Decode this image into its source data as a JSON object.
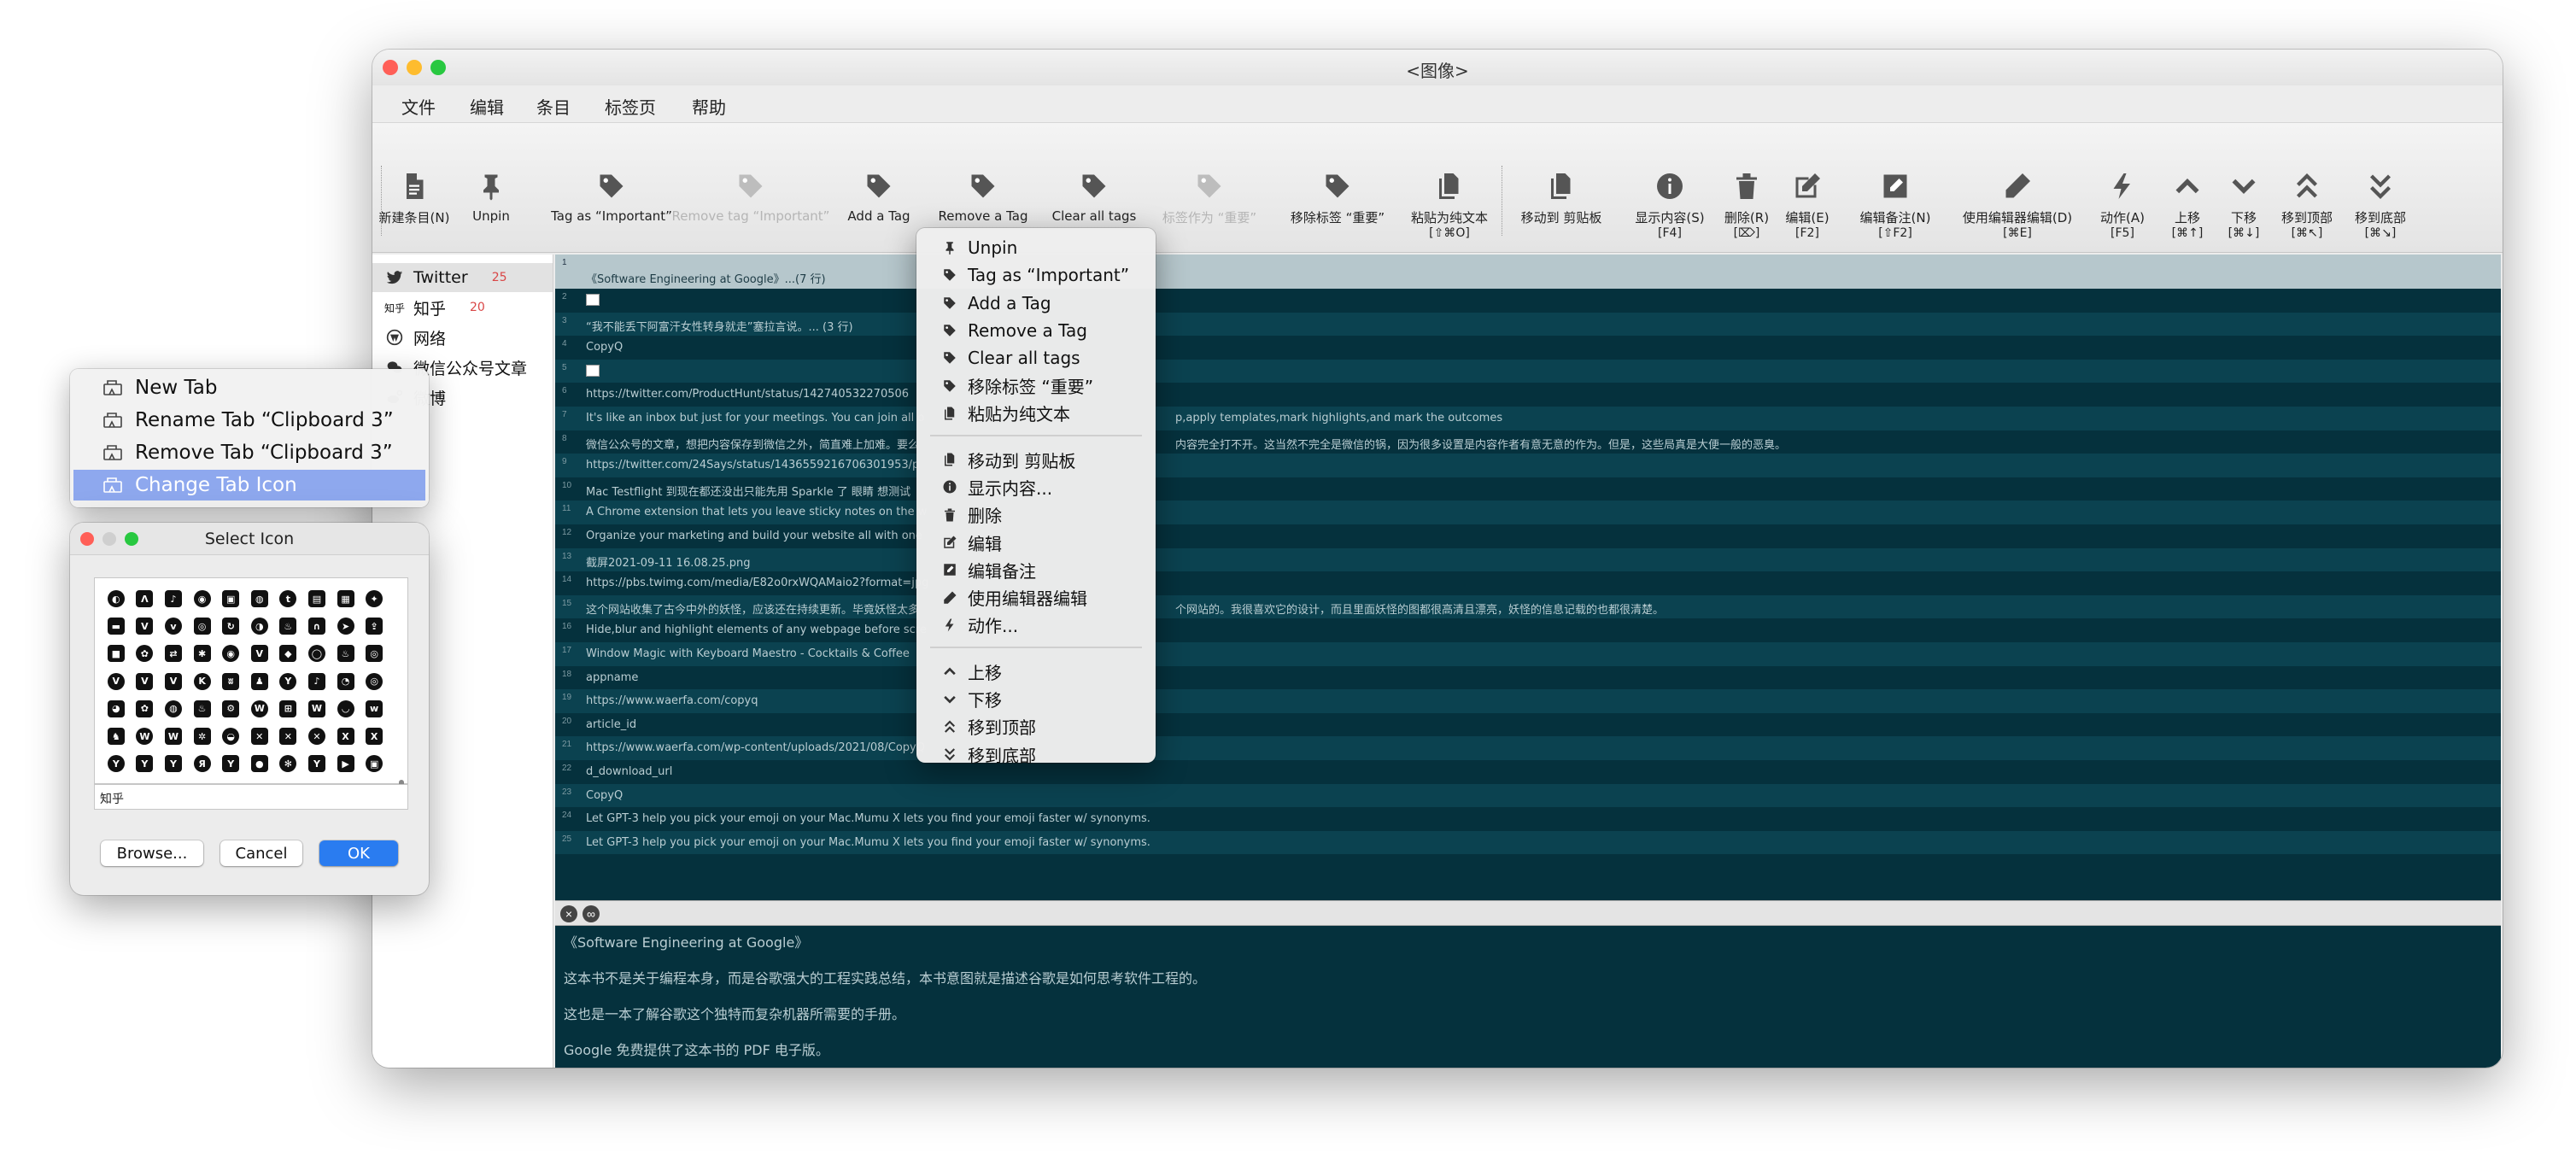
{
  "window": {
    "title": "<图像>"
  },
  "menubar": [
    "文件",
    "编辑",
    "条目",
    "标签页",
    "帮助"
  ],
  "toolbar": [
    {
      "icon": "file-icon",
      "label": "新建条目(N)",
      "enabled": true
    },
    {
      "icon": "pin-icon",
      "label": "Unpin",
      "enabled": true
    },
    {
      "icon": "tag-icon",
      "label": "Tag as “Important”",
      "enabled": true
    },
    {
      "icon": "tag-icon",
      "label": "Remove tag “Important”",
      "enabled": false
    },
    {
      "icon": "tag-icon",
      "label": "Add a Tag",
      "enabled": true
    },
    {
      "icon": "tag-icon",
      "label": "Remove a Tag",
      "enabled": true
    },
    {
      "icon": "tag-icon",
      "label": "Clear all tags",
      "enabled": true
    },
    {
      "icon": "tag-icon",
      "label": "标签作为 “重要”",
      "enabled": false
    },
    {
      "icon": "tag-icon",
      "label": "移除标签 “重要”",
      "enabled": true
    },
    {
      "icon": "copy-icon",
      "label": "粘贴为纯文本",
      "shortcut": "[⇧⌘O]",
      "enabled": true
    },
    {
      "icon": "copy-icon",
      "label": "移动到 剪贴板",
      "enabled": true
    },
    {
      "icon": "info-icon",
      "label": "显示内容(S)",
      "shortcut": "[F4]",
      "enabled": true
    },
    {
      "icon": "trash-icon",
      "label": "删除(R)",
      "shortcut": "[⌦]",
      "enabled": true
    },
    {
      "icon": "edit-icon",
      "label": "编辑(E)",
      "shortcut": "[F2]",
      "enabled": true
    },
    {
      "icon": "edit-note-icon",
      "label": "编辑备注(N)",
      "shortcut": "[⇧F2]",
      "enabled": true
    },
    {
      "icon": "pencil-icon",
      "label": "使用编辑器编辑(D)",
      "shortcut": "[⌘E]",
      "enabled": true
    },
    {
      "icon": "bolt-icon",
      "label": "动作(A)",
      "shortcut": "[F5]",
      "enabled": true
    },
    {
      "icon": "chevron-up-icon",
      "label": "上移",
      "shortcut": "[⌘↑]",
      "enabled": true
    },
    {
      "icon": "chevron-down-icon",
      "label": "下移",
      "shortcut": "[⌘↓]",
      "enabled": true
    },
    {
      "icon": "double-chevron-up-icon",
      "label": "移到顶部",
      "shortcut": "[⌘↖]",
      "enabled": true
    },
    {
      "icon": "double-chevron-down-icon",
      "label": "移到底部",
      "shortcut": "[⌘↘]",
      "enabled": true
    }
  ],
  "sidebar": {
    "tabs": [
      {
        "icon": "twitter-icon",
        "label": "Twitter",
        "count": "25",
        "selected": true
      },
      {
        "icon": "zhihu-icon",
        "icon_text": "知乎",
        "label": "知乎",
        "count": "20",
        "selected": false
      },
      {
        "icon": "wordpress-icon",
        "label": "网络",
        "count": "",
        "selected": false
      },
      {
        "icon": "wechat-icon",
        "label": "微信公众号文章",
        "count": "",
        "selected": false
      },
      {
        "icon": "weibo-icon",
        "label": "微博",
        "count": "",
        "selected": false
      }
    ]
  },
  "items": [
    {
      "num": "1",
      "text": "《Software Engineering at Google》...(7 行)"
    },
    {
      "num": "2",
      "text": "",
      "image": true
    },
    {
      "num": "3",
      "text": "“我不能丢下阿富汗女性转身就走”塞拉言说。... (3 行)"
    },
    {
      "num": "4",
      "text": "CopyQ"
    },
    {
      "num": "5",
      "text": "",
      "image": true
    },
    {
      "num": "6",
      "text": "https://twitter.com/ProductHunt/status/142740532270506"
    },
    {
      "num": "7",
      "text": "It's like an inbox but just for your meetings. You can join all o"
    },
    {
      "num": "8",
      "text": "微信公众号的文章，想把内容保存到微信之外，简直难上加难。要么"
    },
    {
      "num": "9",
      "text": "https://twitter.com/24Says/status/1436559216706301953/p"
    },
    {
      "num": "10",
      "text": "Mac Testflight 到现在都还没出只能先用 Sparkle 了 眼睛 想测试"
    },
    {
      "num": "11",
      "text": "A Chrome extension that lets you leave sticky notes on the w"
    },
    {
      "num": "12",
      "text": "Organize your marketing and build your website all with one"
    },
    {
      "num": "13",
      "text": "截屏2021-09-11 16.08.25.png"
    },
    {
      "num": "14",
      "text": "https://pbs.twimg.com/media/E82o0rxWQAMaio2?format=jpg"
    },
    {
      "num": "15",
      "text": "这个网站收集了古今中外的妖怪，应该还在持续更新。毕竟妖怪太多"
    },
    {
      "num": "16",
      "text": "Hide,blur and highlight elements of any webpage before scre"
    },
    {
      "num": "17",
      "text": "Window Magic with Keyboard Maestro - Cocktails & Coffee"
    },
    {
      "num": "18",
      "text": "appname"
    },
    {
      "num": "19",
      "text": "https://www.waerfa.com/copyq"
    },
    {
      "num": "20",
      "text": "article_id"
    },
    {
      "num": "21",
      "text": "https://www.waerfa.com/wp-content/uploads/2021/08/CopyQ"
    },
    {
      "num": "22",
      "text": "d_download_url"
    },
    {
      "num": "23",
      "text": "CopyQ"
    },
    {
      "num": "24",
      "text": "Let GPT-3 help you pick your emoji on your Mac.Mumu X lets you find your emoji faster w/ synonyms."
    },
    {
      "num": "25",
      "text": "Let GPT-3 help you pick your emoji on your Mac.Mumu X lets you find your emoji faster w/ synonyms."
    }
  ],
  "row_tails": [
    {
      "row": 7,
      "text": "p,apply templates,mark highlights,and mark the outcomes"
    },
    {
      "row": 8,
      "text": "内容完全打不开。这当然不完全是微信的锅，因为很多设置是内容作者有意无意的作为。但是，这些局真是大便一般的恶臭。"
    },
    {
      "row": 15,
      "text": "个网站的。我很喜欢它的设计，而且里面妖怪的图都很高清且漂亮，妖怪的信息记载的也都很清楚。"
    }
  ],
  "preview": {
    "lines": [
      "《Software Engineering at Google》",
      "这本书不是关于编程本身，而是谷歌强大的工程实践总结，本书意图就是描述谷歌是如何思考软件工程的。",
      "这也是一本了解谷歌这个独特而复杂机器所需要的手册。",
      "Google 免费提供了这本书的 PDF 电子版。"
    ]
  },
  "context_menu": {
    "groups": [
      [
        {
          "icon": "pin-icon",
          "label": "Unpin"
        },
        {
          "icon": "tag-icon",
          "label": "Tag as “Important”"
        },
        {
          "icon": "tag-icon",
          "label": "Add a Tag"
        },
        {
          "icon": "tag-icon",
          "label": "Remove a Tag"
        },
        {
          "icon": "tag-icon",
          "label": "Clear all tags"
        },
        {
          "icon": "tag-icon",
          "label": "移除标签 “重要”"
        },
        {
          "icon": "copy-icon",
          "label": "粘贴为纯文本"
        }
      ],
      [
        {
          "icon": "copy-icon",
          "label": "移动到 剪贴板"
        },
        {
          "icon": "info-icon",
          "label": "显示内容..."
        },
        {
          "icon": "trash-icon",
          "label": "删除"
        },
        {
          "icon": "edit-icon",
          "label": "编辑"
        },
        {
          "icon": "edit-note-icon",
          "label": "编辑备注"
        },
        {
          "icon": "pencil-icon",
          "label": "使用编辑器编辑"
        },
        {
          "icon": "bolt-icon",
          "label": "动作..."
        }
      ],
      [
        {
          "icon": "chevron-up-icon",
          "label": "上移"
        },
        {
          "icon": "chevron-down-icon",
          "label": "下移"
        },
        {
          "icon": "double-chevron-up-icon",
          "label": "移到顶部"
        },
        {
          "icon": "double-chevron-down-icon",
          "label": "移到底部"
        }
      ]
    ]
  },
  "tab_menu": {
    "items": [
      {
        "label": "New Tab",
        "highlighted": false
      },
      {
        "label": "Rename Tab “Clipboard 3”",
        "highlighted": false
      },
      {
        "label": "Remove Tab “Clipboard 3”",
        "highlighted": false
      },
      {
        "label": "Change Tab Icon",
        "highlighted": true
      }
    ]
  },
  "select_icon_dialog": {
    "title": "Select Icon",
    "current_icon_text": "知乎",
    "icons": [
      "opera",
      "aviato",
      "tiktok",
      "chrome",
      "docs",
      "tripadvisor",
      "tumblr",
      "book",
      "twitch",
      "twitter",
      "vimeo",
      "vine",
      "vk",
      "qq",
      "circle",
      "weibo",
      "steam",
      "magnet",
      "telegram",
      "share",
      "square",
      "wechat",
      "usb",
      "bluetooth",
      "chrome-o",
      "vimeo-v",
      "wolf",
      "github",
      "fire",
      "skype",
      "vimeo",
      "vine",
      "vk",
      "vk2",
      "wiki",
      "vsee",
      "yandex",
      "tiktok",
      "skype2",
      "weibo2",
      "weibo3",
      "wechat2",
      "whatsapp",
      "wix",
      "settings",
      "wikipedia",
      "windows",
      "wix",
      "wodu",
      "wodu2",
      "wolf2",
      "wordpress",
      "wordpress2",
      "ladybug",
      "wordpress3",
      "xbox",
      "xbox2",
      "x-icon",
      "xing",
      "x2",
      "yahoo",
      "yelp",
      "yahoo2",
      "yandex2",
      "yoast",
      "stop",
      "yelp2",
      "yoast2",
      "youtube",
      "youtube2"
    ]
  },
  "dialog_buttons": {
    "browse": "Browse...",
    "cancel": "Cancel",
    "ok": "OK"
  }
}
